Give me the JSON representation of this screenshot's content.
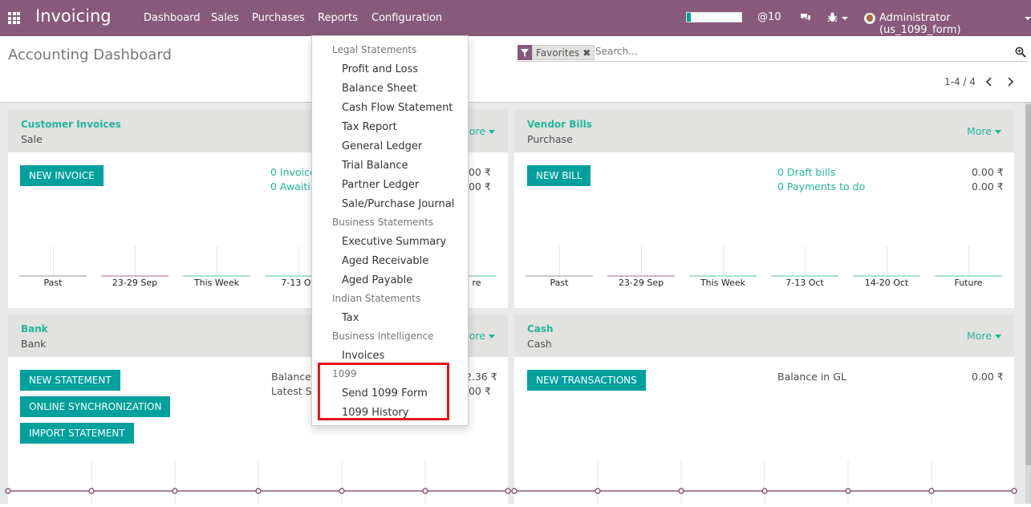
{
  "navbar": {
    "app_name": "Invoicing",
    "menu": [
      "Dashboard",
      "Sales",
      "Purchases",
      "Reports",
      "Configuration"
    ],
    "progress_fraction": 0.08,
    "messages_label": "@10",
    "user_label": "Administrator (us_1099_form)",
    "bg_color": "#875a7b"
  },
  "control_panel": {
    "title": "Accounting Dashboard",
    "facet": "Favorites",
    "facet_remove": "✖",
    "search_placeholder": "Search...",
    "pager": "1-4 / 4"
  },
  "cards": {
    "customer_invoices": {
      "title": "Customer Invoices",
      "subtitle": "Sale",
      "more": "More",
      "button": "NEW INVOICE",
      "link1": "0 Invoice",
      "link2": "0 Awaitin",
      "amount1": ".00 ₹",
      "amount2": ".00 ₹",
      "chart_labels": [
        "Past",
        "23-29 Sep",
        "This Week",
        "7-13 Oc",
        "re"
      ]
    },
    "vendor_bills": {
      "title": "Vendor Bills",
      "subtitle": "Purchase",
      "more": "More",
      "button": "NEW BILL",
      "link1": "0 Draft bills",
      "link2": "0 Payments to do",
      "amount1": "0.00 ₹",
      "amount2": "0.00 ₹",
      "chart_labels": [
        "Past",
        "23-29 Sep",
        "This Week",
        "7-13 Oct",
        "14-20 Oct",
        "Future"
      ]
    },
    "bank": {
      "title": "Bank",
      "subtitle": "Bank",
      "more": "More",
      "buttons": [
        "NEW STATEMENT",
        "ONLINE SYNCHRONIZATION",
        "IMPORT STATEMENT"
      ],
      "label1": "Balance",
      "label2": "Latest St",
      "amount1": "2.36 ₹",
      "amount2": ".00 ₹"
    },
    "cash": {
      "title": "Cash",
      "subtitle": "Cash",
      "more": "More",
      "button": "NEW TRANSACTIONS",
      "label1": "Balance in GL",
      "amount1": "0.00 ₹"
    }
  },
  "reports_menu": {
    "sections": [
      {
        "header": "Legal Statements",
        "items": [
          "Profit and Loss",
          "Balance Sheet",
          "Cash Flow Statement",
          "Tax Report",
          "General Ledger",
          "Trial Balance",
          "Partner Ledger",
          "Sale/Purchase Journal"
        ]
      },
      {
        "header": "Business Statements",
        "items": [
          "Executive Summary",
          "Aged Receivable",
          "Aged Payable"
        ]
      },
      {
        "header": "Indian Statements",
        "items": [
          "Tax"
        ]
      },
      {
        "header": "Business Intelligence",
        "items": [
          "Invoices"
        ]
      },
      {
        "header": "1099",
        "items": [
          "Send 1099 Form",
          "1099 History"
        ]
      }
    ],
    "highlight_color": "#e8141a"
  },
  "colors": {
    "accent": "#00a09d",
    "link": "#21b799",
    "card_header": "#e2e2e0",
    "background": "#e9e9e9"
  }
}
